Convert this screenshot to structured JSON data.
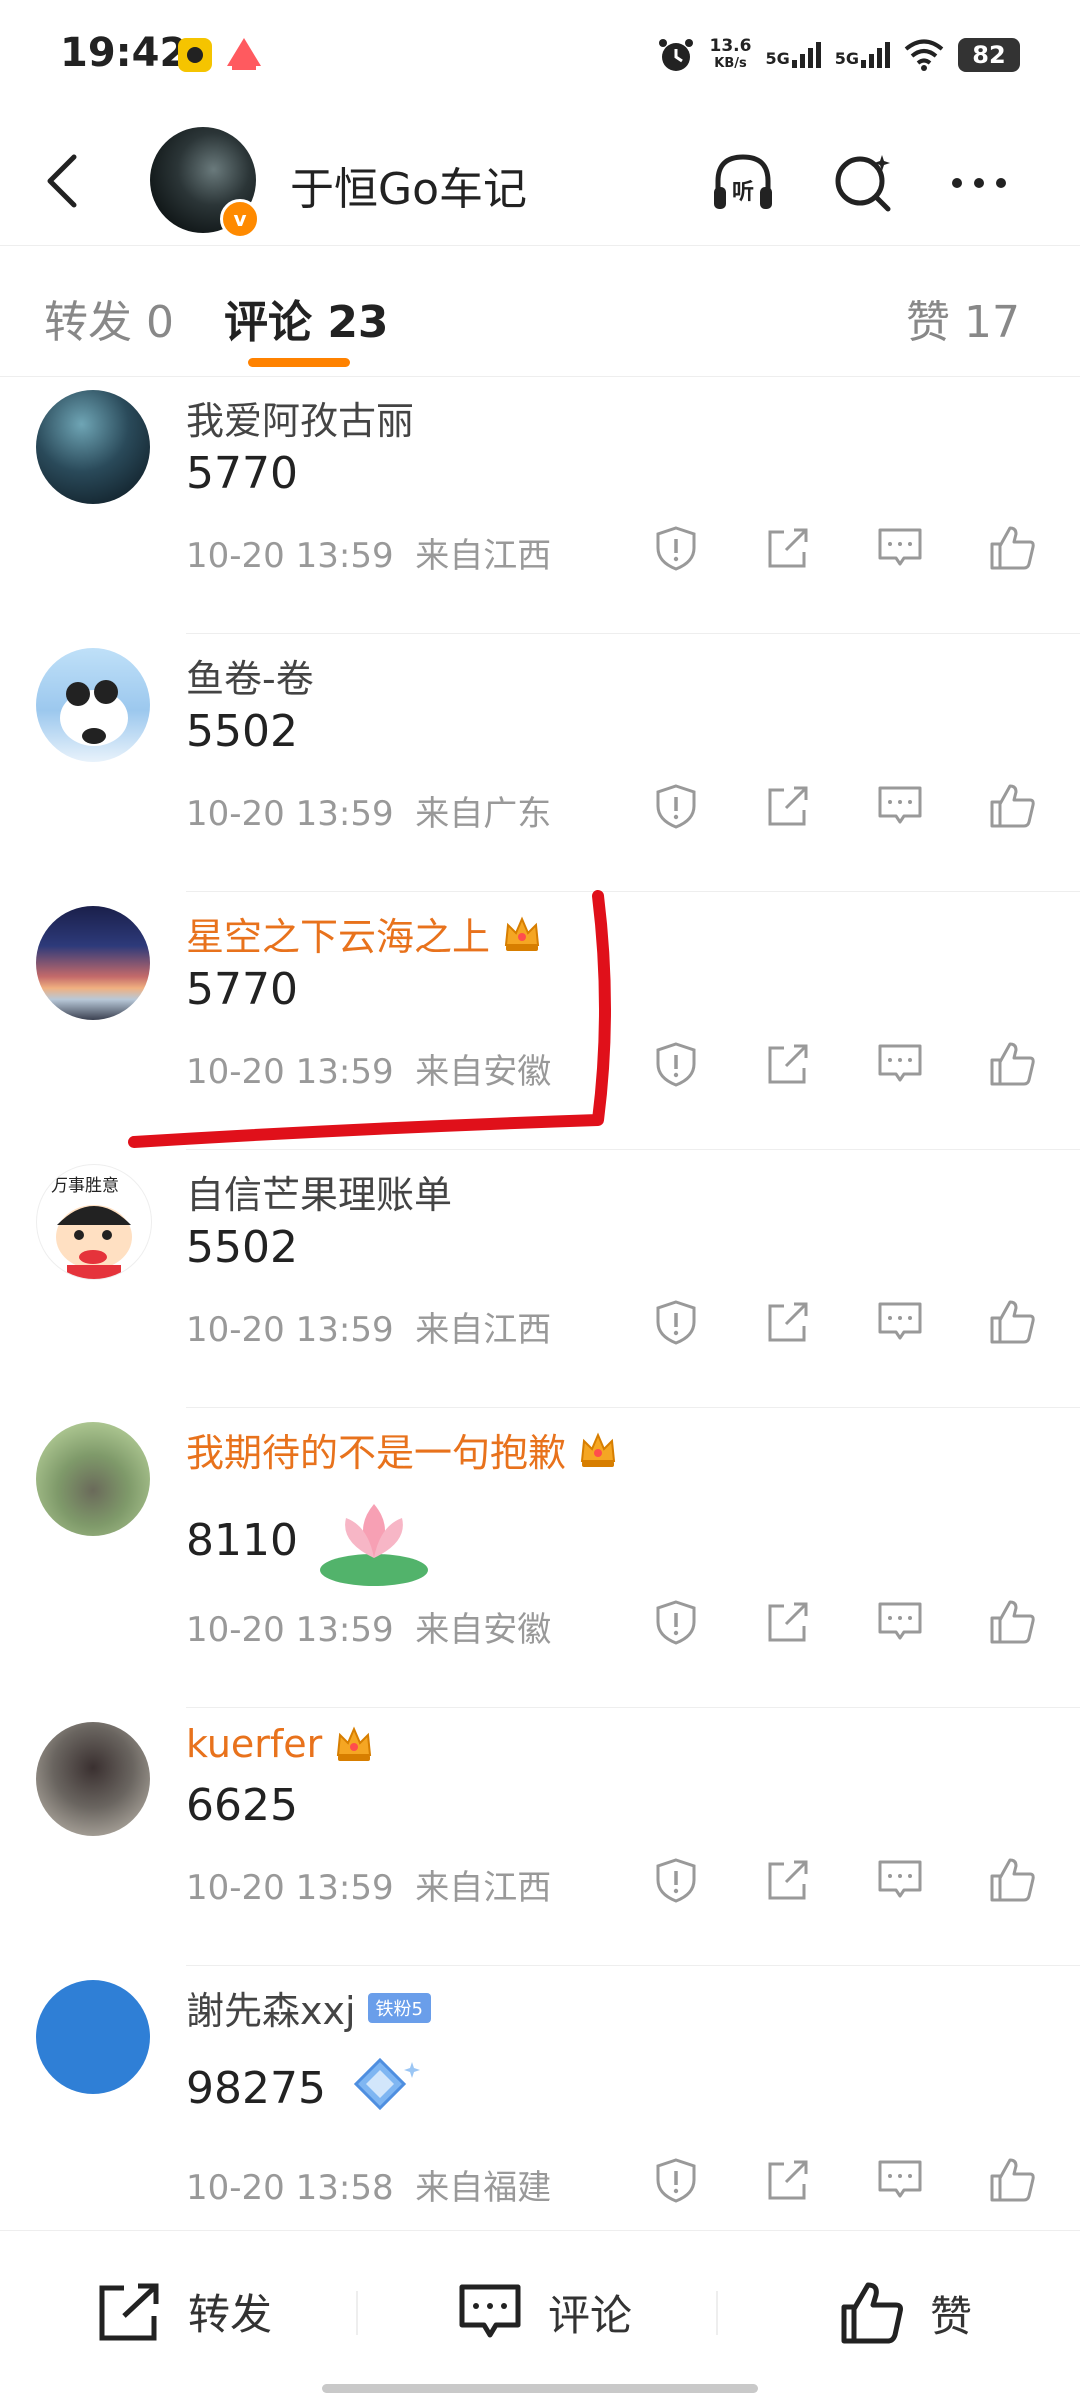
{
  "status_bar": {
    "time": "19:42",
    "net_speed_value": "13.6",
    "net_speed_unit": "KB/s",
    "signal1": "5G",
    "signal2": "5G",
    "battery": "82"
  },
  "header": {
    "author_name": "于恒Go车记",
    "listen_icon": "headphones-listen-icon",
    "search_icon": "search-sparkle-icon",
    "more_icon": "more-icon"
  },
  "tabs": [
    {
      "label": "转发 0"
    },
    {
      "label": "评论 23"
    },
    {
      "label": "赞 17"
    }
  ],
  "comments": [
    {
      "user": "我爱阿孜古丽",
      "text": "5770",
      "time": "10-20 13:59",
      "location": "来自江西",
      "vip": false
    },
    {
      "user": "鱼卷-卷",
      "text": "5502",
      "time": "10-20 13:59",
      "location": "来自广东",
      "vip": false
    },
    {
      "user": "星空之下云海之上",
      "text": "5770",
      "time": "10-20 13:59",
      "location": "来自安徽",
      "vip": true
    },
    {
      "user": "自信芒果理账单",
      "text": "5502",
      "time": "10-20 13:59",
      "location": "来自江西",
      "vip": false,
      "avatar_text": "万事胜意"
    },
    {
      "user": "我期待的不是一句抱歉",
      "text": "8110",
      "time": "10-20 13:59",
      "location": "来自安徽",
      "vip": true
    },
    {
      "user": "kuerfer",
      "text": "6625",
      "time": "10-20 13:59",
      "location": "来自江西",
      "vip": true
    },
    {
      "user": "謝先森xxj",
      "badge": "铁粉5",
      "text": "98275",
      "time": "10-20 13:58",
      "location": "来自福建",
      "vip": false
    }
  ],
  "bottom_bar": {
    "repost": "转发",
    "comment": "评论",
    "like": "赞"
  },
  "colors": {
    "accent": "#ff8200",
    "vip_name": "#e8721c",
    "annotation": "#e0101a"
  }
}
